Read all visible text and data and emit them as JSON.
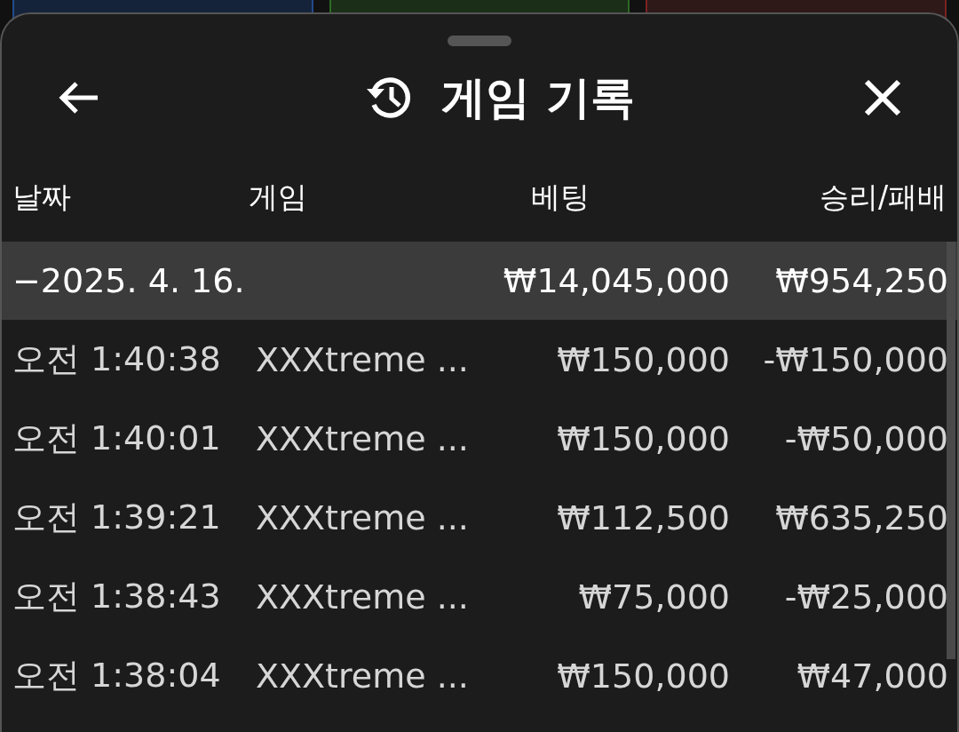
{
  "sheet": {
    "title": "게임 기록"
  },
  "table": {
    "columns": [
      "날짜",
      "게임",
      "베팅",
      "승리/패배"
    ],
    "group": {
      "date": "−2025. 4. 16.",
      "bet": "₩14,045,000",
      "result": "₩954,250"
    },
    "rows": [
      {
        "time": "오전 1:40:38",
        "game": "XXXtreme ...",
        "bet": "₩150,000",
        "result": "-₩150,000"
      },
      {
        "time": "오전 1:40:01",
        "game": "XXXtreme ...",
        "bet": "₩150,000",
        "result": "-₩50,000"
      },
      {
        "time": "오전 1:39:21",
        "game": "XXXtreme ...",
        "bet": "₩112,500",
        "result": "₩635,250"
      },
      {
        "time": "오전 1:38:43",
        "game": "XXXtreme ...",
        "bet": "₩75,000",
        "result": "-₩25,000"
      },
      {
        "time": "오전 1:38:04",
        "game": "XXXtreme ...",
        "bet": "₩150,000",
        "result": "₩47,000"
      }
    ]
  }
}
